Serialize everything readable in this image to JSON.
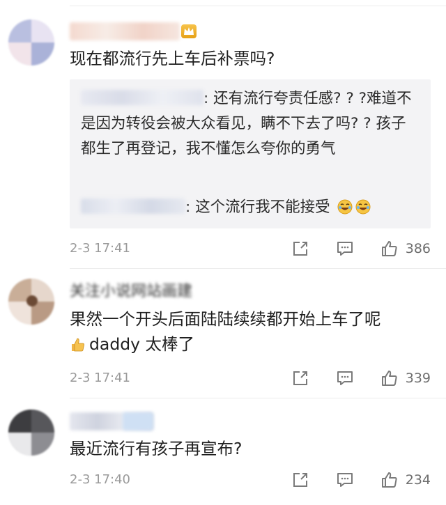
{
  "comments": [
    {
      "text": "现在都流行先上车后补票吗?",
      "replies": [
        {
          "text": ": 还有流行夸责任感? ? ?难道不是因为转役会被大众看见，瞒不下去了吗? ? 孩子都生了再登记，我不懂怎么夸你的勇气"
        },
        {
          "text": ": 这个流行我不能接受"
        }
      ],
      "time": "2-3 17:41",
      "likes": "386"
    },
    {
      "nickname": "关注小说网站画建",
      "text_line1": "果然一个开头后面陆陆续续都开始上车了呢",
      "text_line2": "daddy 太棒了",
      "time": "2-3 17:41",
      "likes": "339"
    },
    {
      "text": "最近流行有孩子再宣布?",
      "time": "2-3 17:40",
      "likes": "234"
    }
  ],
  "icons": {
    "share": "share-icon",
    "comment": "comment-icon",
    "like": "thumbs-up-icon",
    "badge": "crown-badge-icon",
    "emoji_laugh": "laughing-crying-emoji-icon",
    "emoji_thumb": "thumbs-up-emoji-icon"
  },
  "colors": {
    "text": "#1f1f1f",
    "meta": "#9a9a9a",
    "reply_bg": "#f3f3f5",
    "badge": "#e6a117"
  }
}
